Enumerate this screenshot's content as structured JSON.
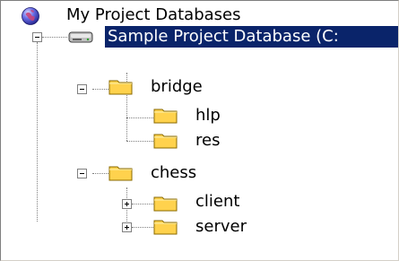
{
  "tree": {
    "root": {
      "label": "My Project Databases",
      "icon": "globe-icon"
    },
    "database": {
      "label": "Sample Project Database (C:",
      "icon": "database-drive-icon",
      "selected": true,
      "expanded": true
    },
    "folders": [
      {
        "label": "bridge",
        "icon": "folder-icon",
        "expanded": true,
        "children": [
          {
            "label": "hlp",
            "icon": "folder-icon"
          },
          {
            "label": "res",
            "icon": "folder-icon"
          }
        ]
      },
      {
        "label": "chess",
        "icon": "folder-icon",
        "expanded": true,
        "children": [
          {
            "label": "client",
            "icon": "folder-icon",
            "expanded": false
          },
          {
            "label": "server",
            "icon": "folder-icon",
            "expanded": false
          }
        ]
      }
    ]
  },
  "colors": {
    "selection": "#0a246a",
    "folder": "#ffd24d",
    "connector": "#808080"
  }
}
